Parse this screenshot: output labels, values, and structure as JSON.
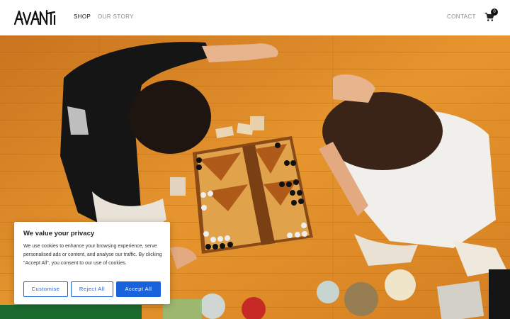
{
  "header": {
    "logo_text": "AVANTI",
    "nav": {
      "shop": "SHOP",
      "our_story": "OUR STORY",
      "contact": "CONTACT"
    },
    "cart_count": "0"
  },
  "hero": {
    "image_description_icon": "hero-photo"
  },
  "cookie_banner": {
    "title": "We value your privacy",
    "text": "We use cookies to enhance your browsing experience, serve personalised ads or content, and analyse our traffic. By clicking \"Accept All\", you consent to our use of cookies.",
    "buttons": {
      "customise": "Customise",
      "reject": "Reject All",
      "accept": "Accept All"
    }
  },
  "colors": {
    "accent": "#1863dc",
    "floor": "#d98a2a",
    "nav_active": "#111111",
    "nav_muted": "#8a8a8a"
  }
}
